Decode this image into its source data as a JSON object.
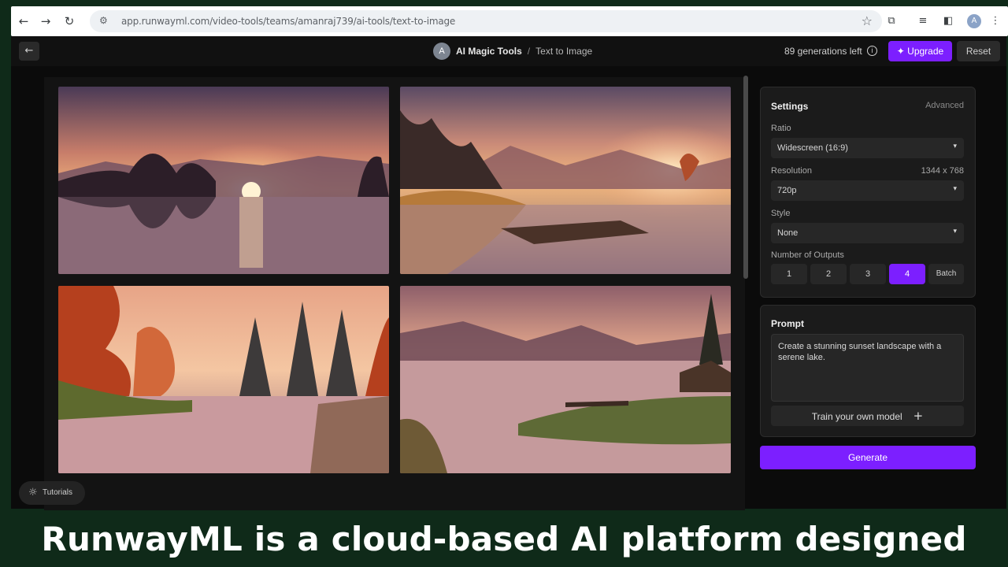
{
  "browser": {
    "url": "app.runwayml.com/video-tools/teams/amanraj739/ai-tools/text-to-image",
    "profile_initial": "A",
    "icons": [
      "back-arrow-icon",
      "forward-arrow-icon",
      "reload-icon",
      "site-settings-icon",
      "bookmark-star-icon",
      "extensions-icon",
      "media-queue-icon",
      "side-panel-icon",
      "kebab-menu-icon"
    ]
  },
  "header": {
    "back_icon": "arrow-left-icon",
    "team_initial": "A",
    "app_name": "AI Magic Tools",
    "separator": "/",
    "page_name": "Text to Image",
    "generations_left": "89 generations left",
    "upgrade_label": "Upgrade",
    "reset_label": "Reset"
  },
  "gallery": {
    "images": [
      {
        "label": "sunset-lake-1"
      },
      {
        "label": "sunset-lake-2"
      },
      {
        "label": "sunset-lake-3"
      },
      {
        "label": "sunset-lake-4"
      }
    ]
  },
  "settings": {
    "title": "Settings",
    "advanced_label": "Advanced",
    "ratio_label": "Ratio",
    "ratio_value": "Widescreen (16:9)",
    "resolution_label": "Resolution",
    "resolution_dims": "1344 x 768",
    "resolution_value": "720p",
    "style_label": "Style",
    "style_value": "None",
    "outputs_label": "Number of Outputs",
    "outputs_options": [
      "1",
      "2",
      "3",
      "4",
      "Batch"
    ],
    "outputs_selected": "4"
  },
  "prompt": {
    "title": "Prompt",
    "text": "Create a stunning sunset landscape with a serene lake.",
    "train_label": "Train your own model",
    "train_plus": "+"
  },
  "generate_label": "Generate",
  "tutorials_label": "Tutorials",
  "caption": "RunwayML is a cloud-based AI platform designed",
  "colors": {
    "accent": "#7c1fff",
    "app_bg": "#0b0b0b",
    "panel_bg": "#1b1b1b",
    "caption_bg": "#0f2a19"
  }
}
